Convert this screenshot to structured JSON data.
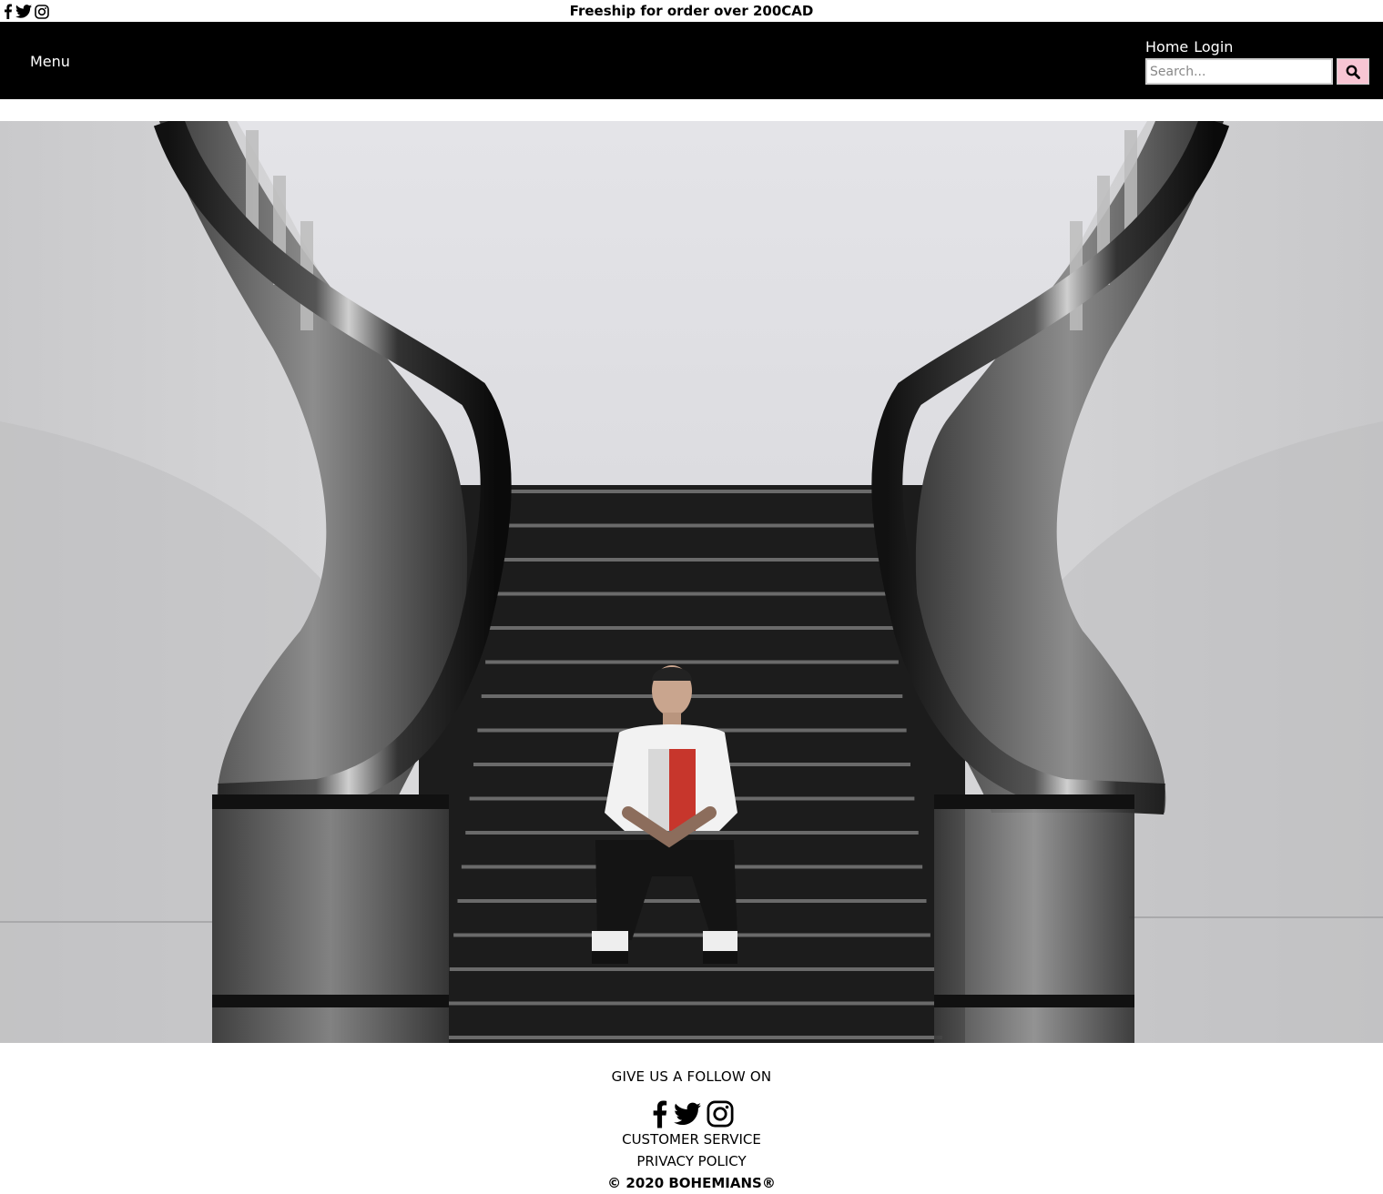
{
  "topbar": {
    "promo": "Freeship for order over 200CAD",
    "social_icons": [
      "facebook-icon",
      "twitter-icon",
      "instagram-icon"
    ]
  },
  "navbar": {
    "menu_label": "Menu",
    "links": [
      "Home",
      "Login"
    ],
    "search": {
      "placeholder": "Search...",
      "value": "",
      "button_icon": "search-icon",
      "button_color": "#f7c5d3"
    }
  },
  "hero": {
    "image": "photo of a man in a white graphic t-shirt sitting on a grand double staircase"
  },
  "footer": {
    "follow_label": "GIVE US A FOLLOW ON",
    "social_icons": [
      "facebook-icon",
      "twitter-icon",
      "instagram-icon"
    ],
    "links": [
      "CUSTOMER SERVICE",
      "PRIVACY POLICY"
    ],
    "copyright": "© 2020 BOHEMIANS®"
  },
  "colors": {
    "navbar_bg": "#000000",
    "search_button": "#f7c5d3",
    "page_bg": "#ffffff"
  }
}
